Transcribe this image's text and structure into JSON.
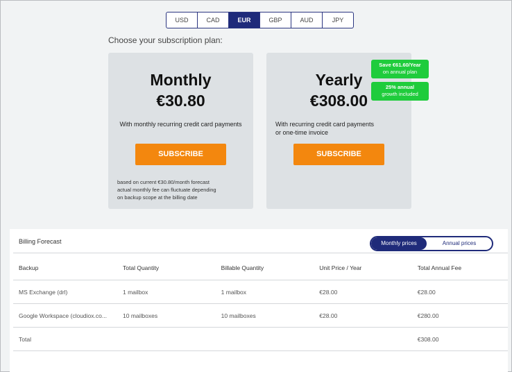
{
  "currency_selector": {
    "options": [
      "USD",
      "CAD",
      "EUR",
      "GBP",
      "AUD",
      "JPY"
    ],
    "selected": "EUR"
  },
  "heading": "Choose your subscription plan:",
  "plans": {
    "monthly": {
      "name": "Monthly",
      "price": "€30.80",
      "description": "With monthly recurring credit card payments",
      "subscribe_label": "SUBSCRIBE",
      "note_lines": [
        "based on current €30.80/month forecast",
        "actual monthly fee can fluctuate depending",
        "on backup scope at the billing date"
      ]
    },
    "yearly": {
      "name": "Yearly",
      "price": "€308.00",
      "description_lines": [
        "With recurring credit card payments",
        "or one-time invoice"
      ],
      "subscribe_label": "SUBSCRIBE",
      "badges": [
        {
          "line1": "Save €61.60/Year",
          "line2": "on annual plan"
        },
        {
          "line1": "25% annual",
          "line2": "growth included"
        }
      ]
    }
  },
  "billing_forecast": {
    "title": "Billing Forecast",
    "toggle": {
      "active": "Monthly prices",
      "inactive": "Annual prices"
    },
    "columns": [
      "Backup",
      "Total Quantity",
      "Billable Quantity",
      "Unit Price / Year",
      "Total Annual Fee"
    ],
    "rows": [
      [
        "MS Exchange (drl)",
        "1 mailbox",
        "1 mailbox",
        "€28.00",
        "€28.00"
      ],
      [
        "Google Workspace (cloudiox.co...",
        "10 mailboxes",
        "10 mailboxes",
        "€28.00",
        "€280.00"
      ],
      [
        "Total",
        "",
        "",
        "",
        "€308.00"
      ]
    ]
  },
  "colors": {
    "navy": "#1f2b7a",
    "orange": "#f3870e",
    "green": "#1fcc3c",
    "card_bg": "#dde1e4"
  }
}
